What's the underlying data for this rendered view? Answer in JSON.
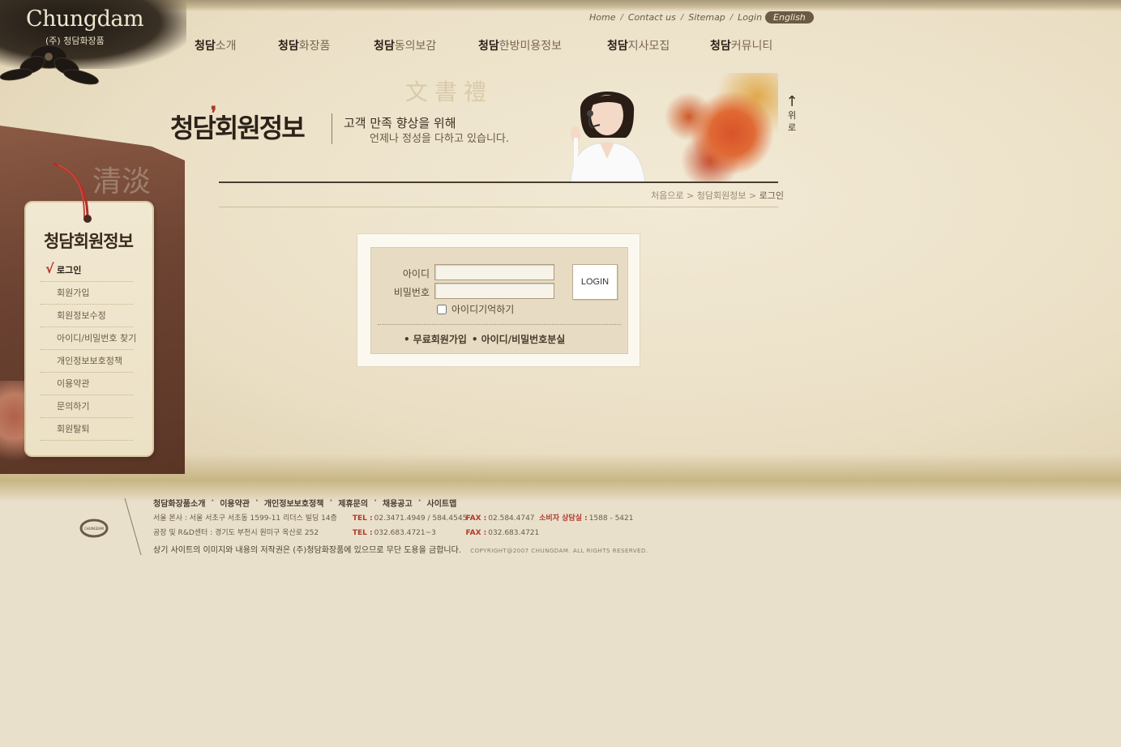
{
  "logo": {
    "brand": "Chungdam",
    "sub": "(주) 청담화장품"
  },
  "util_links": {
    "home": "Home",
    "contact": "Contact us",
    "sitemap": "Sitemap",
    "login": "Login",
    "english": "English"
  },
  "gnb": [
    {
      "strong": "청담",
      "rest": "소개"
    },
    {
      "strong": "청담",
      "rest": "화장품"
    },
    {
      "strong": "청담",
      "rest": "동의보감"
    },
    {
      "strong": "청담",
      "rest": "한방미용정보"
    },
    {
      "strong": "청담",
      "rest": "지사모집"
    },
    {
      "strong": "청담",
      "rest": "커뮤니티"
    }
  ],
  "sidebar": {
    "book_char": "清淡",
    "title": "청담회원정보",
    "items": [
      {
        "label": "로그인"
      },
      {
        "label": "회원가입"
      },
      {
        "label": "회원정보수정"
      },
      {
        "label": "아이디/비밀번호 찾기"
      },
      {
        "label": "개인정보보호정책"
      },
      {
        "label": "이용약관"
      },
      {
        "label": "문의하기"
      },
      {
        "label": "회원탈퇴"
      }
    ]
  },
  "banner": {
    "title_a": "청담",
    "title_b": "회원정보",
    "sub1": "고객 만족 향상을 위해",
    "sub2": "언제나 정성을 다하고 있습니다.",
    "top_label": "위로",
    "top_arrow": "↑"
  },
  "breadcrumb": {
    "home": "처음으로",
    "section": "청담회원정보",
    "current": "로그인",
    "sep": ">"
  },
  "login": {
    "id_label": "아이디",
    "pw_label": "비밀번호",
    "id_value": "",
    "pw_value": "",
    "button": "LOGIN",
    "remember": "아이디기억하기",
    "join": "무료회원가입",
    "find": "아이디/비밀번호분실",
    "bullet": "•"
  },
  "footer": {
    "nav": [
      "청담화장품소개",
      "이용약관",
      "개인정보보호정책",
      "제휴문의",
      "채용공고",
      "사이트맵"
    ],
    "sep": "·",
    "line1": {
      "addr": "서울 본사 : 서울 서초구 서초동 1599-11 리더스 빌딩 14층",
      "tel_tag": "TEL :",
      "tel": "02.3471.4949 / 584.4545",
      "fax_tag": "FAX :",
      "fax": "02.584.4747",
      "cs_tag": "소비자 상담실 :",
      "cs": "1588 - 5421"
    },
    "line2": {
      "addr": "공장 및 R&D센터 : 경기도 부천시 원미구 옥산로 252",
      "tel_tag": "TEL :",
      "tel": "032.683.4721~3",
      "fax_tag": "FAX :",
      "fax": "032.683.4721"
    },
    "copy": "상기 사이트의 이미지와 내용의 저작권은 (주)청담화장품에 있으므로 무단 도용을 금합니다.",
    "copy_en": "COPYRIGHT@2007 CHUNGDAM. ALL RIGHTS RESERVED.",
    "logo_text": "CHUNGDAM"
  },
  "colors": {
    "accent_red": "#b03a2c",
    "ink": "#2c2219",
    "parchment": "#ebe0c6"
  }
}
